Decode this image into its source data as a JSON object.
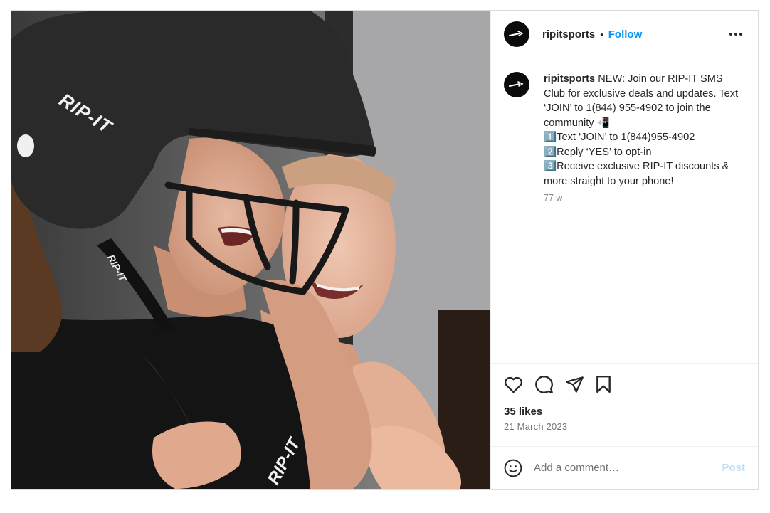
{
  "post": {
    "username": "ripitsports",
    "separator": "•",
    "follow_label": "Follow",
    "more_icon": "more-horizontal-icon",
    "image": {
      "helmet_logo_text": "RIP-IT",
      "lanyard_text": "RIP-IT",
      "jersey_logo_text": "RIP-IT",
      "palette": {
        "helmet": "#2b2b2b",
        "jersey": "#151515",
        "background": "#6b6b6b",
        "skin": "#d9a58c"
      }
    },
    "caption": {
      "username": "ripitsports",
      "text": " NEW: Join our RIP-IT SMS Club for exclusive deals and updates. Text ‘JOIN’ to 1(844) 955-4902 to join the community 📲\n1️⃣Text ‘JOIN’ to 1(844)955-4902\n2️⃣Reply ‘YES’ to opt-in\n3️⃣Receive exclusive RIP-IT discounts & more straight to your phone!",
      "time": "77 w"
    },
    "actions": {
      "like_icon": "heart-icon",
      "comment_icon": "comment-icon",
      "share_icon": "share-icon",
      "save_icon": "bookmark-icon"
    },
    "likes": "35 likes",
    "date": "21 March 2023",
    "comment_box": {
      "emoji_icon": "emoji-icon",
      "placeholder": "Add a comment…",
      "post_label": "Post"
    },
    "colors": {
      "accent": "#0095f6",
      "post_disabled": "#c0dffd",
      "text": "#262626",
      "muted": "#737373"
    }
  }
}
